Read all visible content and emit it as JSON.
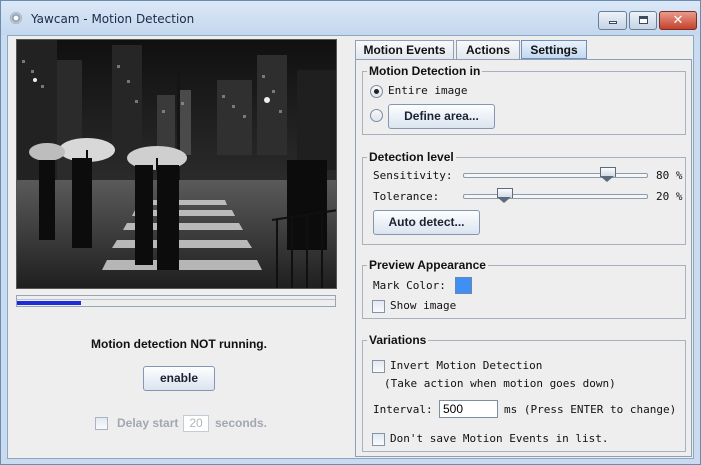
{
  "window": {
    "title": "Yawcam - Motion Detection",
    "controls": {
      "minimize": "minimize-icon",
      "maximize": "maximize-icon",
      "close": "✕"
    }
  },
  "left": {
    "status_text": "Motion detection NOT running.",
    "enable_label": "enable",
    "progress_fraction": 0.2,
    "delay": {
      "label_before": "Delay start",
      "value": "20",
      "label_after": "seconds.",
      "checked": false,
      "enabled": false
    }
  },
  "tabs": [
    {
      "label": "Motion Events",
      "active": false
    },
    {
      "label": "Actions",
      "active": false
    },
    {
      "label": "Settings",
      "active": true
    }
  ],
  "settings": {
    "motion_detection_in": {
      "title": "Motion Detection in",
      "entire_image_label": "Entire image",
      "entire_image_selected": true,
      "define_area_label": "Define area..."
    },
    "detection_level": {
      "title": "Detection level",
      "sensitivity_label": "Sensitivity:",
      "sensitivity_value": 80,
      "sensitivity_text": "80 %",
      "tolerance_label": "Tolerance:",
      "tolerance_value": 20,
      "tolerance_text": "20 %",
      "auto_detect_label": "Auto detect..."
    },
    "preview_appearance": {
      "title": "Preview Appearance",
      "mark_color_label": "Mark Color:",
      "mark_color": "#3f8ff5",
      "show_image_label": "Show image",
      "show_image_checked": false
    },
    "variations": {
      "title": "Variations",
      "invert_label": "Invert Motion Detection",
      "invert_checked": false,
      "invert_note": "(Take action when motion goes down)",
      "interval_label": "Interval:",
      "interval_value": "500",
      "interval_hint": "ms (Press ENTER to change)",
      "dont_save_label": "Don't save Motion Events in list.",
      "dont_save_checked": false
    }
  },
  "colors": {
    "title_bar": "#c9dbee",
    "close_button": "#c6412b",
    "progress": "#1e2bd6",
    "panel_bg": "#eeeeee"
  }
}
